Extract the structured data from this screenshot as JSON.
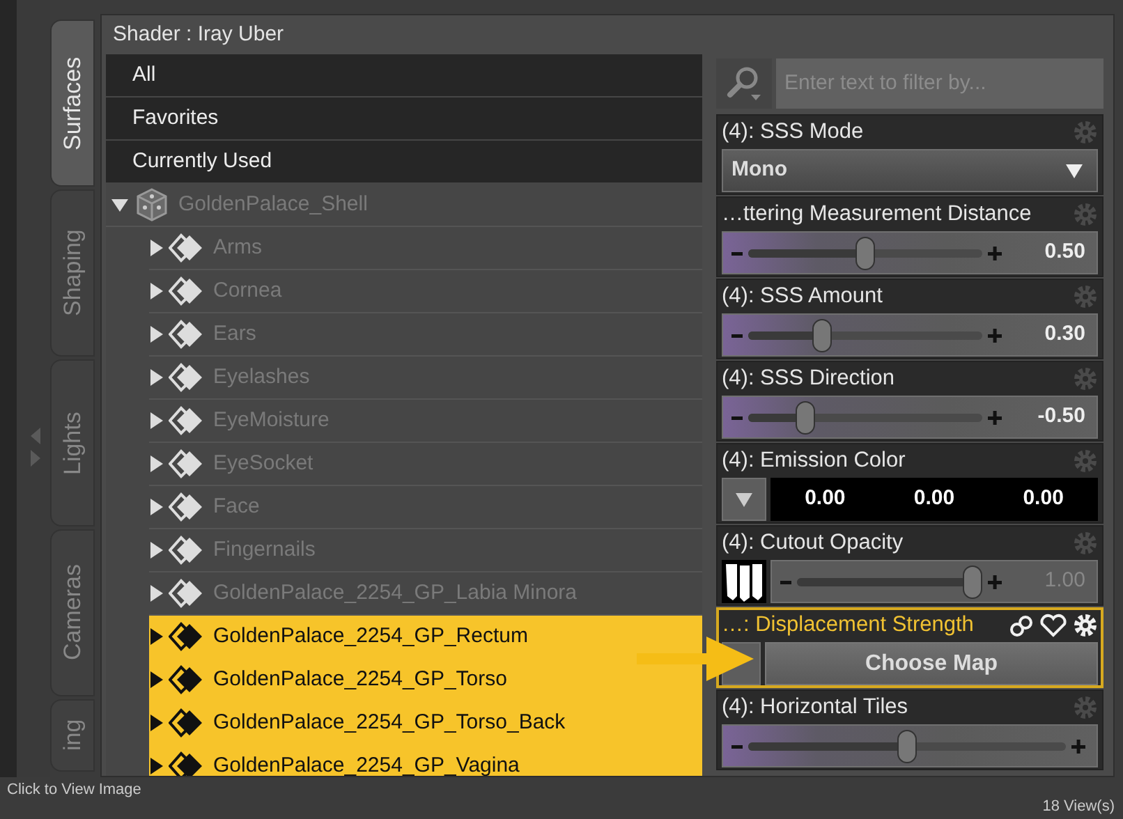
{
  "window": {
    "title": "Shader : Iray Uber"
  },
  "side_tabs": [
    {
      "label": "Surfaces",
      "selected": true
    },
    {
      "label": "Shaping",
      "selected": false
    },
    {
      "label": "Lights",
      "selected": false
    },
    {
      "label": "Cameras",
      "selected": false
    },
    {
      "label": "ing",
      "selected": false
    }
  ],
  "filters": [
    {
      "label": "All"
    },
    {
      "label": "Favorites"
    },
    {
      "label": "Currently Used"
    }
  ],
  "tree": {
    "label": "GoldenPalace_Shell",
    "expanded": true,
    "selected": false,
    "children": [
      {
        "label": "Arms",
        "expanded": false,
        "selected": false
      },
      {
        "label": "Cornea",
        "expanded": false,
        "selected": false
      },
      {
        "label": "Ears",
        "expanded": false,
        "selected": false
      },
      {
        "label": "Eyelashes",
        "expanded": false,
        "selected": false
      },
      {
        "label": "EyeMoisture",
        "expanded": false,
        "selected": false
      },
      {
        "label": "EyeSocket",
        "expanded": false,
        "selected": false
      },
      {
        "label": "Face",
        "expanded": false,
        "selected": false
      },
      {
        "label": "Fingernails",
        "expanded": false,
        "selected": false
      },
      {
        "label": "GoldenPalace_2254_GP_Labia Minora",
        "expanded": false,
        "selected": false
      },
      {
        "label": "GoldenPalace_2254_GP_Rectum",
        "expanded": false,
        "selected": true
      },
      {
        "label": "GoldenPalace_2254_GP_Torso",
        "expanded": false,
        "selected": true
      },
      {
        "label": "GoldenPalace_2254_GP_Torso_Back",
        "expanded": false,
        "selected": true
      },
      {
        "label": "GoldenPalace_2254_GP_Vagina",
        "expanded": false,
        "selected": true
      }
    ]
  },
  "search": {
    "placeholder": "Enter text to filter by..."
  },
  "properties": [
    {
      "kind": "dropdown",
      "label": "(4): SSS Mode",
      "value": "Mono",
      "highlighted": false
    },
    {
      "kind": "slider",
      "label": "…ttering Measurement Distance",
      "level": 0.5,
      "reading": "0.50",
      "highlighted": false
    },
    {
      "kind": "slider",
      "label": "(4): SSS Amount",
      "level": 0.3,
      "reading": "0.30",
      "highlighted": false
    },
    {
      "kind": "slider",
      "label": "(4): SSS Direction",
      "level": 0.22,
      "reading": "-0.50",
      "highlighted": false
    },
    {
      "kind": "color",
      "label": "(4): Emission Color",
      "values": [
        "0.00",
        "0.00",
        "0.00"
      ],
      "highlighted": false
    },
    {
      "kind": "mapped_slider",
      "label": "(4): Cutout Opacity",
      "level": 1,
      "reading": "1.00",
      "highlighted": false
    },
    {
      "kind": "map",
      "label": "…: Displacement Strength",
      "button": "Choose Map",
      "highlighted": true
    },
    {
      "kind": "slider",
      "label": "(4): Horizontal Tiles",
      "level": 0.5,
      "highlighted": false
    }
  ],
  "status_bar": {
    "left": "Click to View Image",
    "right": "18 View(s)"
  }
}
